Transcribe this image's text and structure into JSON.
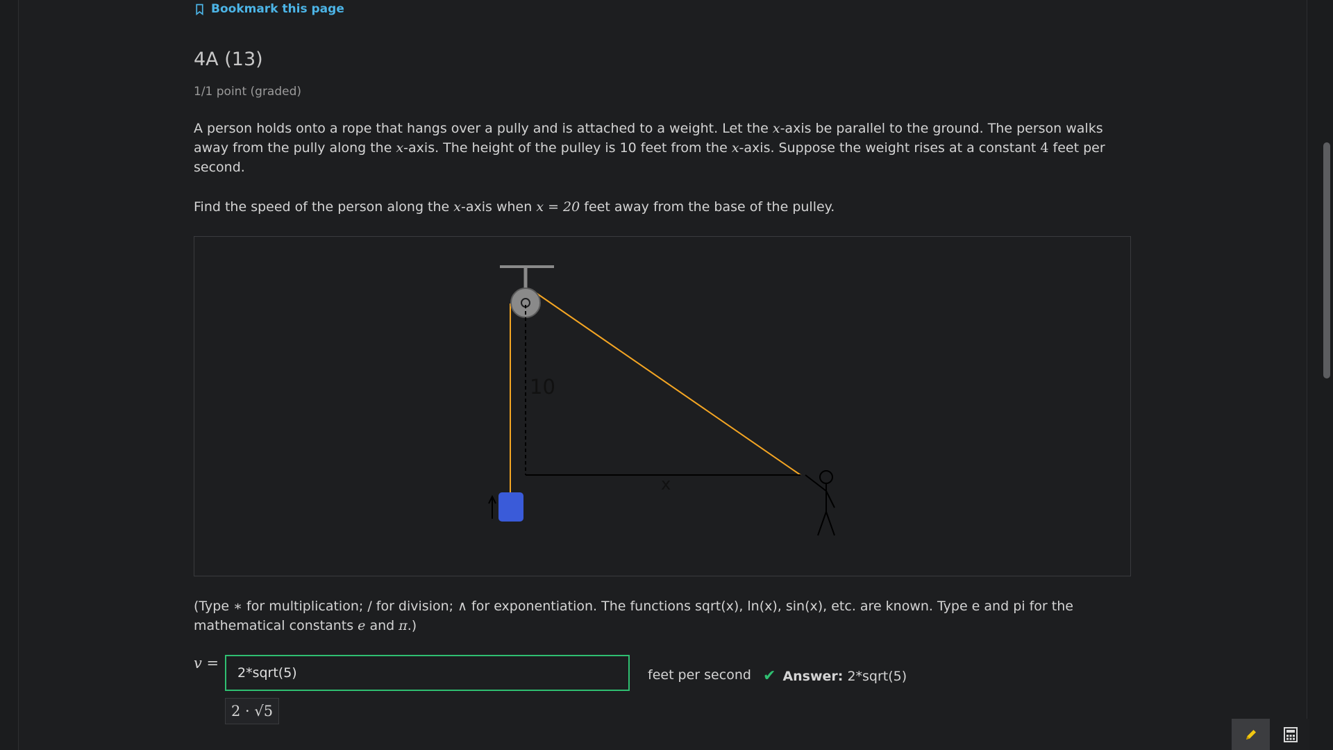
{
  "bookmark": {
    "label": "Bookmark this page"
  },
  "problem": {
    "title": "4A (13)",
    "grading": "1/1 point (graded)",
    "para1_part1": "A person holds onto a rope that hangs over a pully and is attached to a weight. Let the ",
    "var_x": "x",
    "para1_part2": "-axis be parallel to the ground. The person walks away from the pully along the ",
    "para1_part3": "-axis. The height of the pulley is 10 feet from the ",
    "para1_part4": "-axis. Suppose the weight rises at a constant ",
    "rate_value": "4",
    "para1_part5": " feet per second.",
    "para2_part1": "Find the speed of the person along the ",
    "para2_part2": "-axis when ",
    "para2_eq": "x = 20",
    "para2_part3": " feet away from the base of the pulley."
  },
  "figure": {
    "height_label": "10",
    "x_label": "x",
    "colors": {
      "rope": "#f5a623",
      "weight": "#3a5bd9",
      "pulley": "#8a8a8a",
      "line": "#000000"
    }
  },
  "instructions": {
    "part1": "(Type ",
    "star": "∗",
    "part2": " for multiplication; / for division; ",
    "caret": "∧",
    "part3": " for exponentiation. The functions sqrt(x), ln(x), sin(x), etc. are known. Type e and pi for the mathematical constants ",
    "e": "e",
    "and": " and ",
    "pi": "π",
    "part4": ".)"
  },
  "answer": {
    "var_label": "v =",
    "input_value": "2*sqrt(5)",
    "units": "feet per second",
    "status_label": "Answer:",
    "status_value": "2*sqrt(5)",
    "preview": "2 · √5"
  },
  "tools": {
    "pencil_icon": "pencil-icon",
    "calculator_icon": "calculator-icon"
  }
}
